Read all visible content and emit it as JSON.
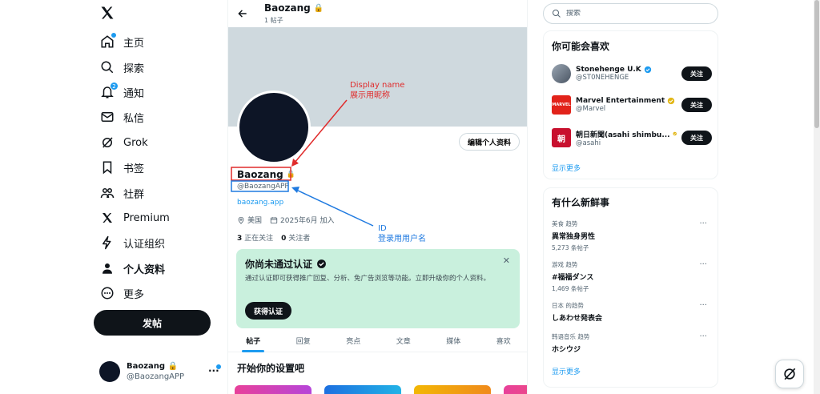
{
  "logo": "X",
  "nav": [
    {
      "label": "主页",
      "icon": "home-icon"
    },
    {
      "label": "探索",
      "icon": "search-icon"
    },
    {
      "label": "通知",
      "icon": "bell-icon",
      "badge": "2"
    },
    {
      "label": "私信",
      "icon": "mail-icon"
    },
    {
      "label": "Grok",
      "icon": "grok-icon"
    },
    {
      "label": "书签",
      "icon": "bookmark-icon"
    },
    {
      "label": "社群",
      "icon": "communities-icon"
    },
    {
      "label": "Premium",
      "icon": "x-icon"
    },
    {
      "label": "认证组织",
      "icon": "lightning-icon"
    },
    {
      "label": "个人资料",
      "icon": "person-icon"
    },
    {
      "label": "更多",
      "icon": "more-circle-icon"
    }
  ],
  "post_button": "发帖",
  "account": {
    "name": "Baozang",
    "handle": "@BaozangAPP"
  },
  "header": {
    "name": "Baozang",
    "post_count": "1 帖子"
  },
  "profile": {
    "name": "Baozang",
    "handle": "@BaozangAPP",
    "link": "baozang.app",
    "location": "美国",
    "joined": "2025年6月 加入",
    "following_count": "3",
    "following_label": "正在关注",
    "followers_count": "0",
    "followers_label": "关注者",
    "edit_button": "编辑个人资料"
  },
  "verify_card": {
    "title": "你尚未通过认证",
    "desc": "通过认证即可获得推广回复、分析、免广告浏览等功能。立即升级你的个人资料。",
    "button": "获得认证",
    "close": "✕"
  },
  "tabs": [
    "帖子",
    "回复",
    "亮点",
    "文章",
    "媒体",
    "喜欢"
  ],
  "setup_title": "开始你的设置吧",
  "search": {
    "placeholder": "搜索"
  },
  "suggestions": {
    "title": "你可能会喜欢",
    "items": [
      {
        "name": "Stonehenge U.K",
        "handle": "@ST0NEHENGE",
        "button": "关注",
        "badge_color": "#1d9bf0"
      },
      {
        "name": "Marvel Entertainment",
        "handle": "@Marvel",
        "button": "关注",
        "badge_color": "#e2b719",
        "avatar_text": "MARVEL"
      },
      {
        "name": "朝日新聞(asahi shimbu...",
        "handle": "@asahi",
        "button": "关注",
        "badge_color": "#e2b719",
        "avatar_text": "朝"
      }
    ],
    "more": "显示更多"
  },
  "trends": {
    "title": "有什么新鲜事",
    "items": [
      {
        "category": "美食 趋势",
        "title": "異常独身男性",
        "count": "5,273 条帖子"
      },
      {
        "category": "游戏 趋势",
        "title": "#福福ダンス",
        "count": "1,469 条帖子"
      },
      {
        "category": "日本 的趋势",
        "title": "しあわせ発表会",
        "count": ""
      },
      {
        "category": "韩语音乐 趋势",
        "title": "ホシウジ",
        "count": ""
      }
    ],
    "more": "显示更多"
  },
  "annotations": {
    "display_name_en": "Display name",
    "display_name_zh": "展示用昵称",
    "id_en": "ID",
    "id_zh": "登录用用户名"
  },
  "colors": {
    "accent": "#1d9bf0",
    "annotation_red": "#e02b2b",
    "annotation_blue": "#1f7ae0",
    "verify_bg": "#c9f0dd"
  }
}
